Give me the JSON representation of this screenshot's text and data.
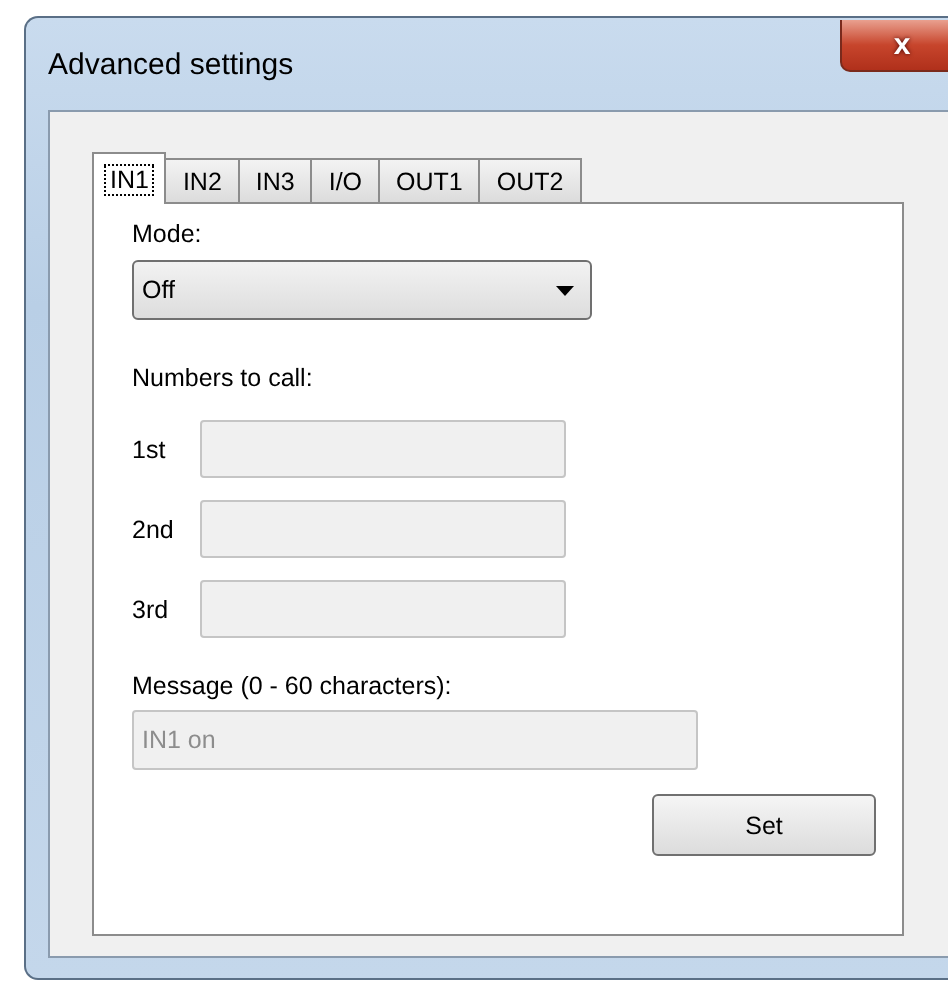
{
  "window": {
    "title": "Advanced settings",
    "close": "x"
  },
  "tabs": [
    {
      "label": "IN1",
      "selected": true
    },
    {
      "label": "IN2",
      "selected": false
    },
    {
      "label": "IN3",
      "selected": false
    },
    {
      "label": "I/O",
      "selected": false
    },
    {
      "label": "OUT1",
      "selected": false
    },
    {
      "label": "OUT2",
      "selected": false
    }
  ],
  "mode": {
    "label": "Mode:",
    "value": "Off"
  },
  "numbers": {
    "label": "Numbers to call:",
    "fields": [
      {
        "label": "1st",
        "disabled": true
      },
      {
        "label": "2nd",
        "disabled": true
      },
      {
        "label": "3rd",
        "disabled": true
      }
    ]
  },
  "message": {
    "label": "Message (0 - 60 characters):",
    "value": "IN1 on",
    "disabled": true
  },
  "buttons": [
    {
      "label": "Set"
    }
  ]
}
